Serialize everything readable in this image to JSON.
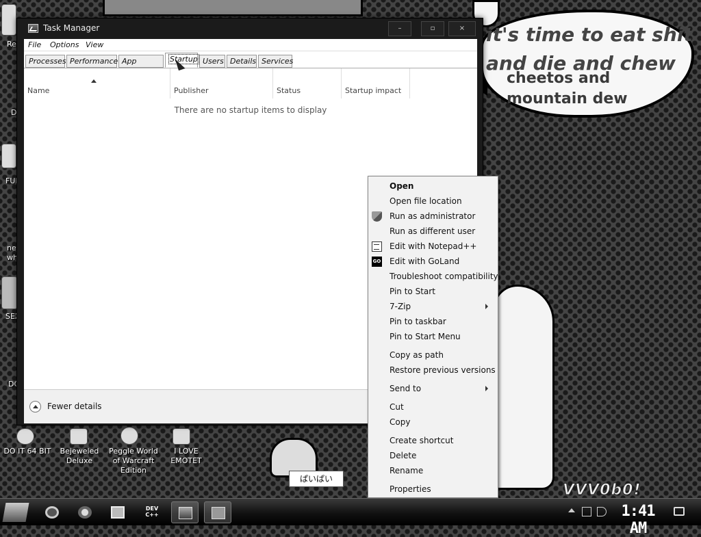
{
  "window": {
    "title": "Task Manager",
    "controls": {
      "minimize": "–",
      "maximize": "▫",
      "close": "×"
    }
  },
  "menubar": {
    "file": "File",
    "options": "Options",
    "view": "View"
  },
  "tabs": [
    {
      "label": "Processes"
    },
    {
      "label": "Performance"
    },
    {
      "label": "App history"
    },
    {
      "label": "Startup",
      "active": true
    },
    {
      "label": "Users"
    },
    {
      "label": "Details"
    },
    {
      "label": "Services"
    }
  ],
  "columns": {
    "name": "Name",
    "publisher": "Publisher",
    "status": "Status",
    "impact": "Startup impact"
  },
  "empty_message": "There are no startup items to display",
  "footer": {
    "fewer_details": "Fewer details"
  },
  "context_menu": {
    "open": "Open",
    "open_location": "Open file location",
    "run_admin": "Run as administrator",
    "run_other_user": "Run as different user",
    "notepad": "Edit with Notepad++",
    "goland": "Edit with GoLand",
    "troubleshoot": "Troubleshoot compatibility",
    "pin_start": "Pin to Start",
    "zip": "7-Zip",
    "pin_taskbar": "Pin to taskbar",
    "pin_start_menu": "Pin to Start Menu",
    "copy_path": "Copy as path",
    "restore": "Restore previous versions",
    "send_to": "Send to",
    "cut": "Cut",
    "copy": "Copy",
    "create_shortcut": "Create shortcut",
    "delete": "Delete",
    "rename": "Rename",
    "properties": "Properties"
  },
  "desktop": {
    "bubble_line1": "it's time to eat shit",
    "bubble_line2": "and die and chew",
    "bubble_line3": "cheetos and",
    "bubble_line4": "mountain dew",
    "watermark": "VVV0b0!",
    "sticker_caption": "ぱいぱい",
    "icons": {
      "doit64": "DO IT 64 BIT",
      "bejeweled": "Bejeweled Deluxe",
      "peggle": "Peggle World of Warcraft Edition",
      "emotet": "I LOVE EMOTET"
    },
    "edge_labels": [
      "Re",
      "D",
      "FUF",
      "ne wh",
      "SEX",
      "DC"
    ]
  },
  "taskbar": {
    "devcpp": "DEV C++",
    "clock": "1:41 AM"
  }
}
